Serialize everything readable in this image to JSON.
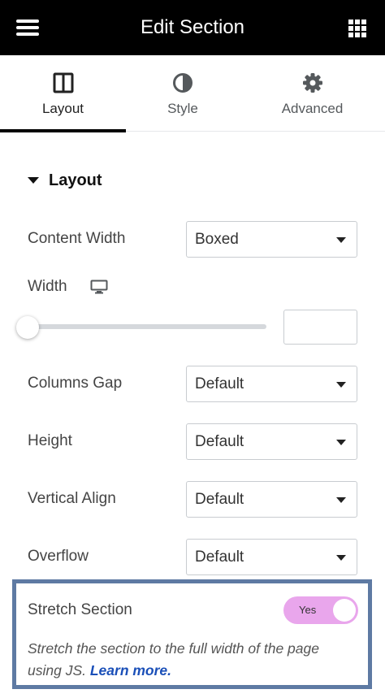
{
  "header": {
    "title": "Edit Section",
    "menu_icon": "hamburger-menu-icon",
    "apps_icon": "grid-apps-icon"
  },
  "tabs": [
    {
      "label": "Layout",
      "icon": "columns-layout-icon",
      "active": true
    },
    {
      "label": "Style",
      "icon": "half-circle-contrast-icon",
      "active": false
    },
    {
      "label": "Advanced",
      "icon": "gear-icon",
      "active": false
    }
  ],
  "layout_section": {
    "title": "Layout",
    "content_width": {
      "label": "Content Width",
      "value": "Boxed"
    },
    "width": {
      "label": "Width",
      "device_icon": "desktop-monitor-icon",
      "slider_fraction": 0,
      "input_value": ""
    },
    "columns_gap": {
      "label": "Columns Gap",
      "value": "Default"
    },
    "height": {
      "label": "Height",
      "value": "Default"
    },
    "vertical_align": {
      "label": "Vertical Align",
      "value": "Default"
    },
    "overflow": {
      "label": "Overflow",
      "value": "Default"
    },
    "stretch_section": {
      "label": "Stretch Section",
      "toggle_text": "Yes",
      "enabled": true,
      "description": "Stretch the section to the full width of the page using JS.",
      "link_text": "Learn more."
    }
  },
  "colors": {
    "header_bg": "#000000",
    "toggle_on": "#e9a6ec",
    "highlight_border": "#5e7aa3",
    "link": "#1a4fb8"
  }
}
